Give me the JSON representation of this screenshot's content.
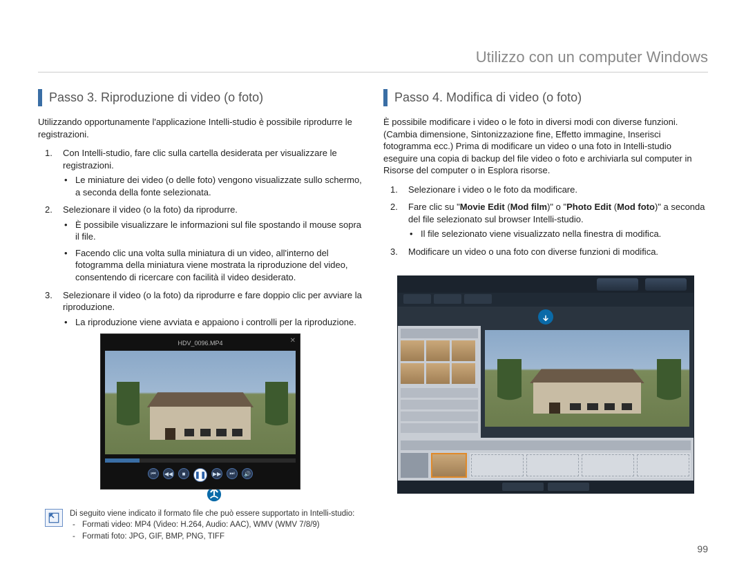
{
  "header": "Utilizzo con un computer Windows",
  "page_number": "99",
  "left": {
    "heading": "Passo 3. Riproduzione di video (o foto)",
    "intro": "Utilizzando opportunamente l'applicazione Intelli-studio è possibile riprodurre le registrazioni.",
    "steps": {
      "s1": "Con Intelli-studio, fare clic sulla cartella desiderata per visualizzare le registrazioni.",
      "s1_b1": "Le miniature dei video (o delle foto) vengono visualizzate sullo schermo, a seconda della fonte selezionata.",
      "s2": "Selezionare il video (o la foto) da riprodurre.",
      "s2_b1": "È possibile visualizzare le informazioni sul file spostando il mouse sopra il file.",
      "s2_b2": "Facendo clic una volta sulla miniatura di un video, all'interno del fotogramma della miniatura viene mostrata la riproduzione del video, consentendo di ricercare con facilità il video desiderato.",
      "s3": "Selezionare il video (o la foto) da riprodurre e fare doppio clic per avviare la riproduzione.",
      "s3_b1": "La riproduzione viene avviata e appaiono i controlli per la riproduzione."
    },
    "player_filename": "HDV_0096.MP4",
    "note": {
      "text": "Di seguito viene indicato il formato file che può essere supportato in Intelli-studio:",
      "d1": "Formati video: MP4 (Video: H.264, Audio: AAC), WMV (WMV 7/8/9)",
      "d2": "Formati foto: JPG, GIF, BMP, PNG, TIFF"
    }
  },
  "right": {
    "heading": "Passo 4. Modifica di video (o foto)",
    "intro": "È possibile modificare i video o le foto in diversi modi con diverse funzioni. (Cambia dimensione, Sintonizzazione fine, Effetto immagine, Inserisci fotogramma ecc.) Prima di modificare un video o una foto in Intelli-studio eseguire una copia di backup del file video o foto e archiviarla sul computer in Risorse del computer o in Esplora risorse.",
    "steps": {
      "s1": "Selezionare i video o le foto da modificare.",
      "s2_pre": "Fare clic su \"",
      "s2_b1": "Movie Edit",
      "s2_p1": " (",
      "s2_b2": "Mod film",
      "s2_p2": ")\" o \"",
      "s2_b3": "Photo Edit",
      "s2_p3": " (",
      "s2_b4": "Mod foto",
      "s2_p4": ")\" a seconda del file selezionato sul browser Intelli-studio.",
      "s2_bullet": "Il file selezionato viene visualizzato nella finestra di modifica.",
      "s3": "Modificare un video o una foto con diverse funzioni di modifica."
    }
  }
}
